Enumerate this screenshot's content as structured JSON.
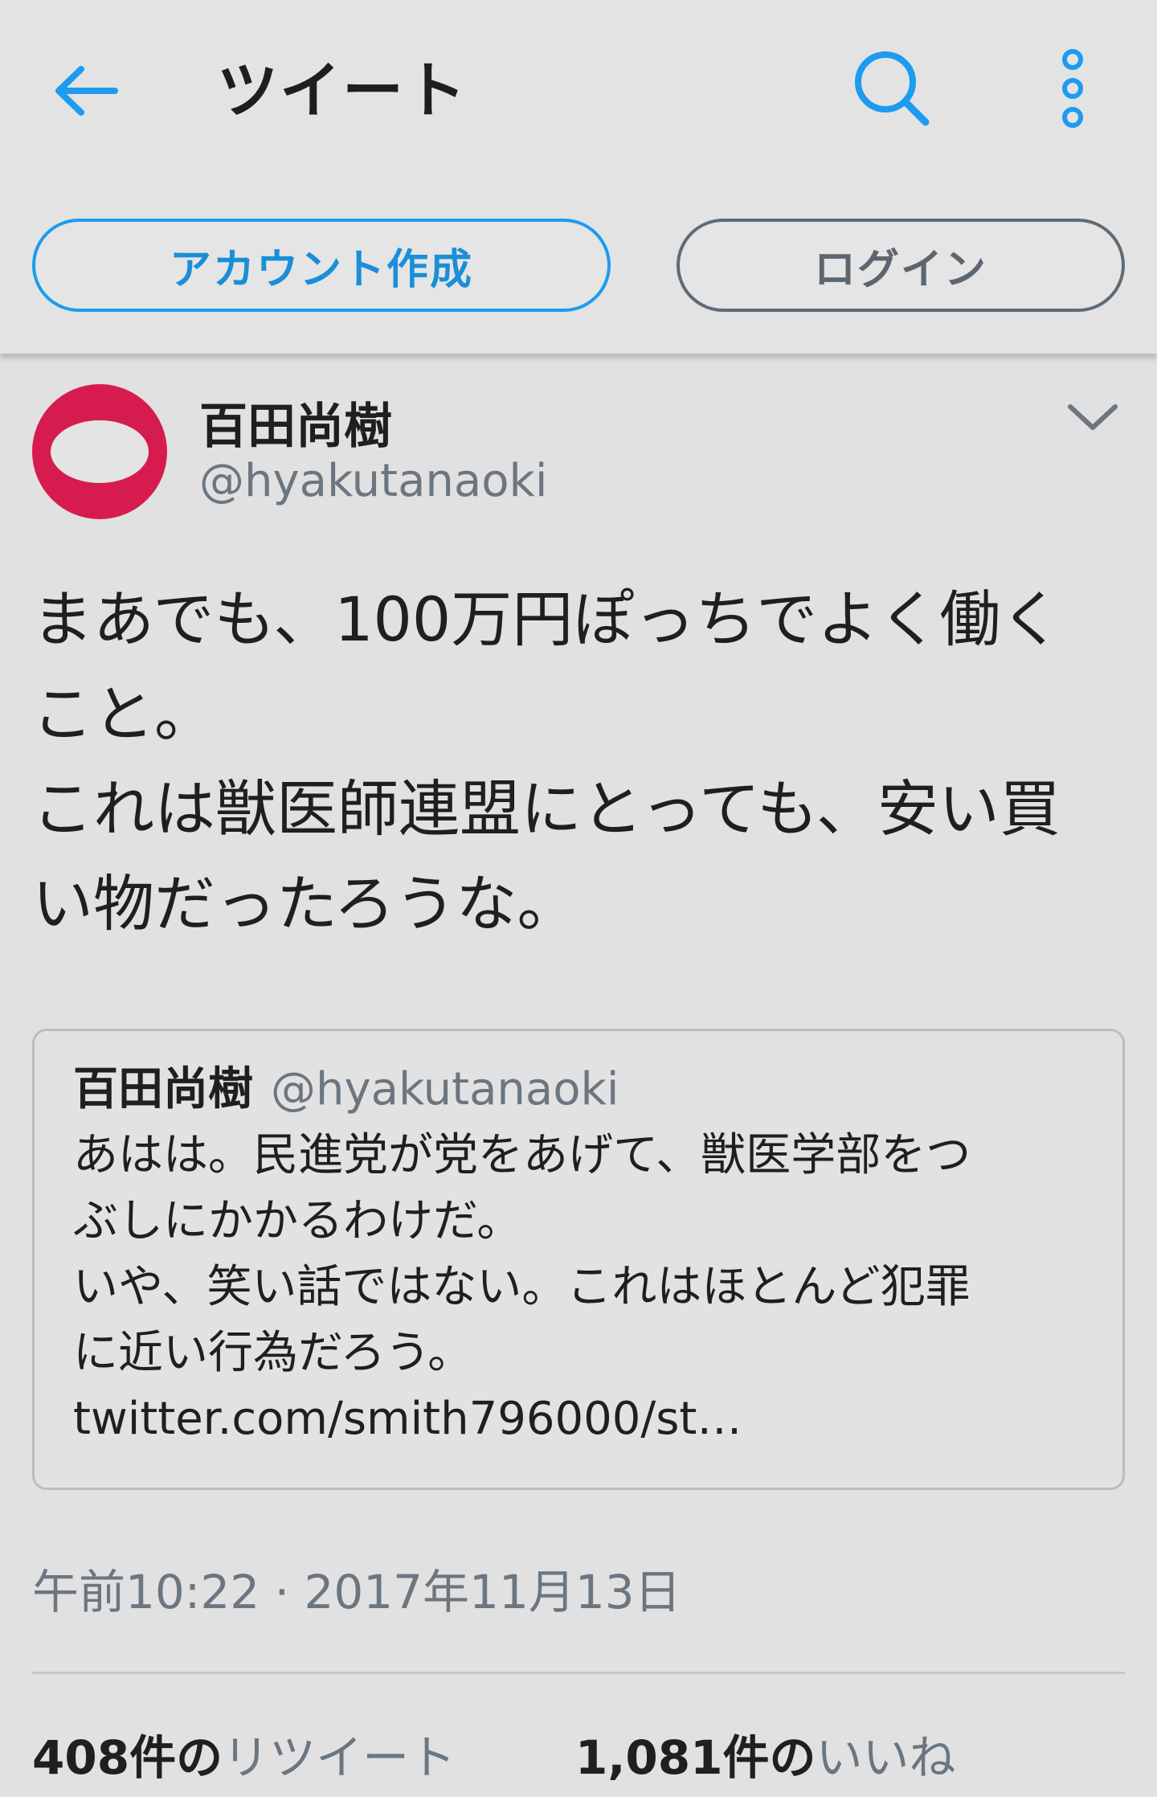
{
  "header": {
    "title": "ツイート",
    "back_icon": "arrow-left-icon",
    "search_icon": "search-icon",
    "more_icon": "more-vertical-icon",
    "accent_color": "#1d9bf0"
  },
  "actions": {
    "signup_label": "アカウント作成",
    "login_label": "ログイン"
  },
  "tweet": {
    "author_name": "百田尚樹",
    "author_handle": "@hyakutanaoki",
    "avatar_colors": {
      "ring": "#d61c4e",
      "inner": "#e4e4e4"
    },
    "body": "まあでも、100万円ぽっちでよく働く\nこと。\nこれは獣医師連盟にとっても、安い買\nい物だったろうな。",
    "quoted": {
      "author_name": "百田尚樹",
      "author_handle": "@hyakutanaoki",
      "text": "あはは。民進党が党をあげて、獣医学部をつ\nぶしにかかるわけだ。\nいや、笑い話ではない。これはほとんど犯罪\nに近い行為だろう。",
      "link": "twitter.com/smith796000/st…"
    },
    "timestamp": "午前10:22 · 2017年11月13日",
    "retweets_count": "408件の",
    "retweets_label": "リツイート",
    "likes_count": "1,081件の",
    "likes_label": "いいね"
  }
}
